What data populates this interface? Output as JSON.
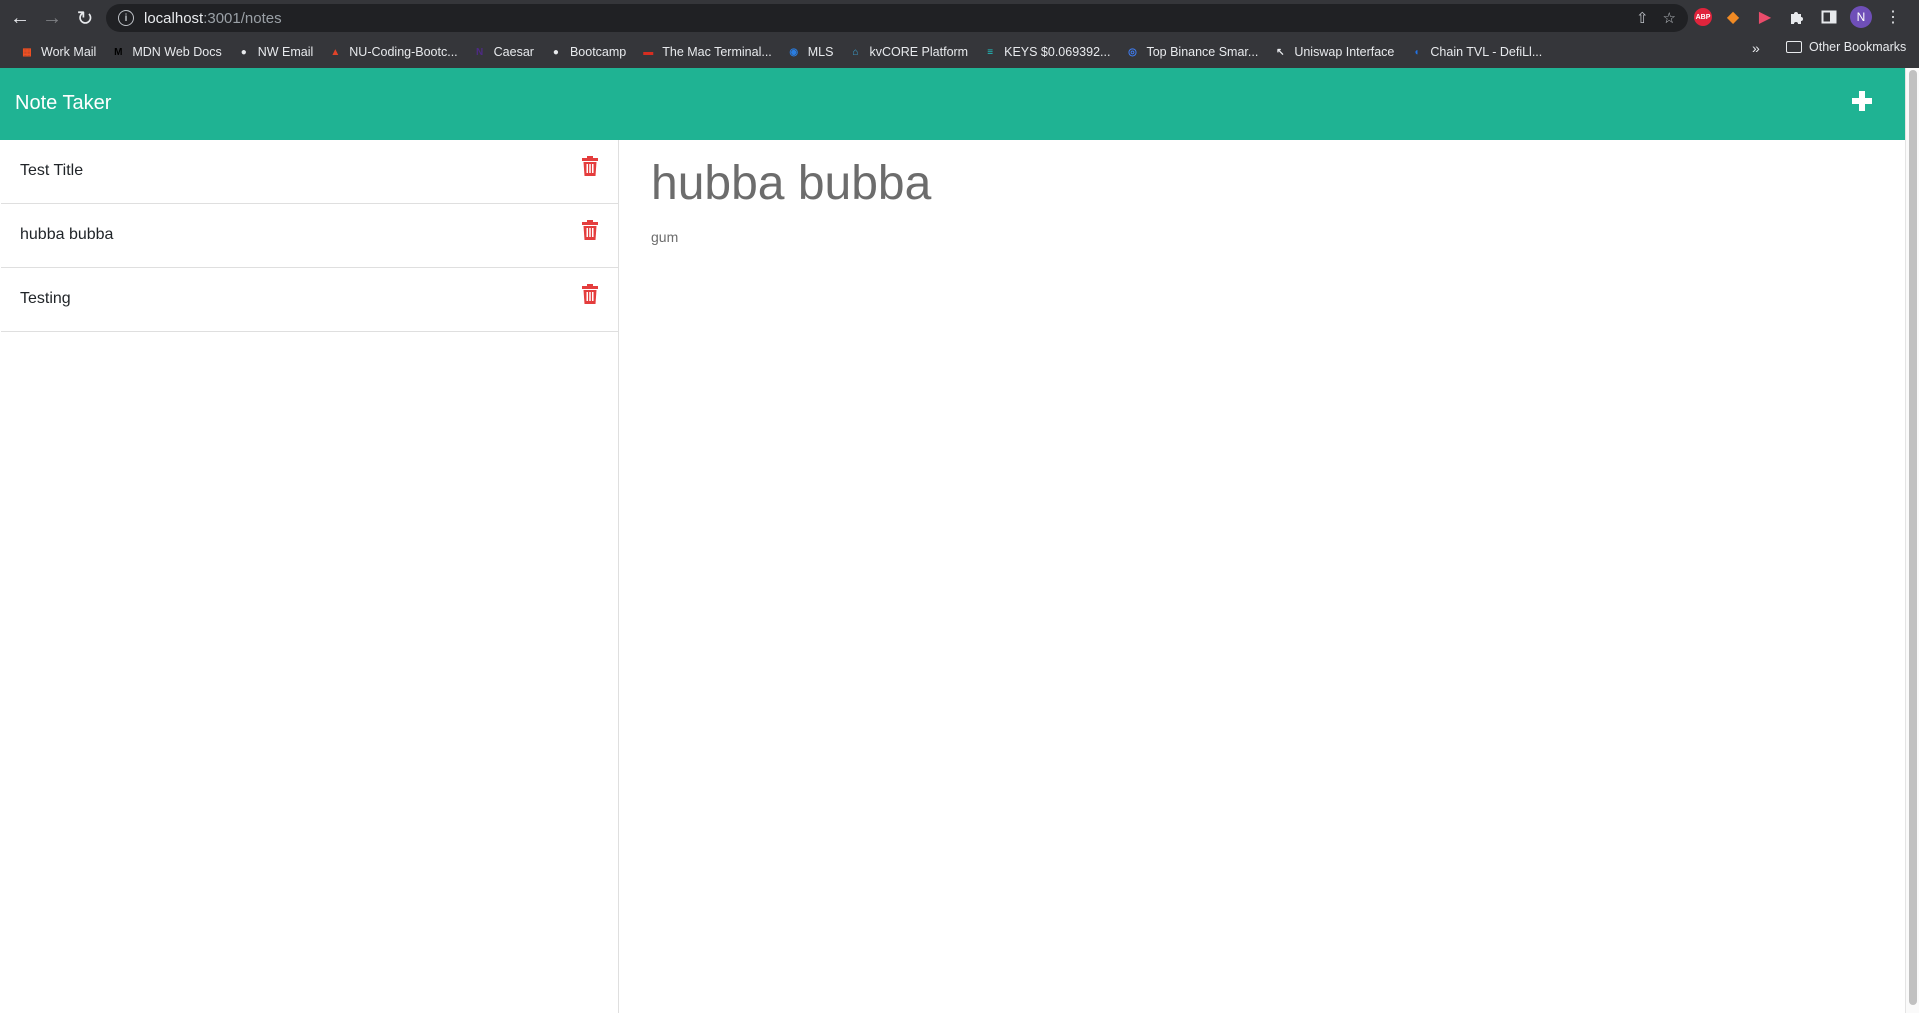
{
  "browser": {
    "url_host": "localhost",
    "url_path": ":3001/notes",
    "profile_initial": "N",
    "extensions": [
      "abp-icon",
      "fox-icon",
      "record-icon",
      "puzzle-icon",
      "sidebar-icon"
    ],
    "abp_label": "ABP"
  },
  "bookmarks": {
    "items": [
      {
        "label": "Work Mail",
        "icon": "windows-icon",
        "color": "#f25022"
      },
      {
        "label": "MDN Web Docs",
        "icon": "mdn-icon",
        "color": "#000000"
      },
      {
        "label": "NW Email",
        "icon": "globe-icon",
        "color": "#e8eaed"
      },
      {
        "label": "NU-Coding-Bootc...",
        "icon": "gitlab-icon",
        "color": "#e24329"
      },
      {
        "label": "Caesar",
        "icon": "n-icon",
        "color": "#4e2a84"
      },
      {
        "label": "Bootcamp",
        "icon": "globe-icon",
        "color": "#e8eaed"
      },
      {
        "label": "The Mac Terminal...",
        "icon": "terminal-icon",
        "color": "#d62d20"
      },
      {
        "label": "MLS",
        "icon": "mls-icon",
        "color": "#2a7de1"
      },
      {
        "label": "kvCORE Platform",
        "icon": "kvcore-icon",
        "color": "#39a9dc"
      },
      {
        "label": "KEYS $0.069392...",
        "icon": "keys-icon",
        "color": "#1ec8c8"
      },
      {
        "label": "Top Binance Smar...",
        "icon": "binance-icon",
        "color": "#3f7df2"
      },
      {
        "label": "Uniswap Interface",
        "icon": "cursor-icon",
        "color": "#e8eaed"
      },
      {
        "label": "Chain TVL - DefiLl...",
        "icon": "defillama-icon",
        "color": "#2172e5"
      }
    ],
    "more": "»",
    "other_label": "Other Bookmarks"
  },
  "app": {
    "brand": "Note Taker",
    "accent": "#1fb393",
    "trash_color": "#e43d3d",
    "notes": [
      {
        "title": "Test Title"
      },
      {
        "title": "hubba bubba"
      },
      {
        "title": "Testing"
      }
    ],
    "active_note": {
      "title": "hubba bubba",
      "text": "gum"
    }
  }
}
